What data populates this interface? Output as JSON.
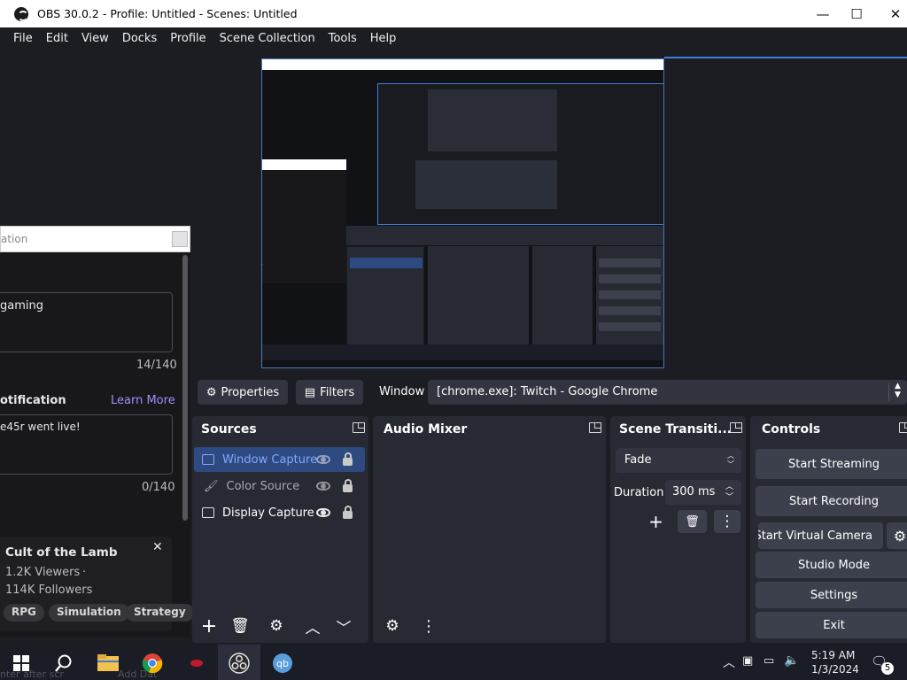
{
  "window": {
    "title": "OBS 30.0.2 - Profile: Untitled - Scenes: Untitled",
    "minimize": "—",
    "maximize": "☐",
    "close": "✕"
  },
  "menu": [
    "File",
    "Edit",
    "View",
    "Docks",
    "Profile",
    "Scene Collection",
    "Tools",
    "Help"
  ],
  "background_window": {
    "title_fragment": "ation",
    "field1_value": "gaming",
    "field1_count": "14/140",
    "section_label": "otification",
    "learn_more": "Learn More",
    "field2_value": "e45r went live!",
    "field2_count": "0/140",
    "card": {
      "title": "Cult of the Lamb",
      "close": "✕",
      "viewers": "1.2K Viewers",
      "dot": "·",
      "followers": "114K Followers",
      "tags": [
        "RPG",
        "Simulation",
        "Strategy"
      ]
    }
  },
  "source_toolbar": {
    "properties": "Properties",
    "filters": "Filters",
    "window_label": "Window",
    "window_value": "[chrome.exe]: Twitch - Google Chrome"
  },
  "sources": {
    "title": "Sources",
    "items": [
      {
        "label": "Window Capture",
        "selected": true,
        "visible": false
      },
      {
        "label": "Color Source",
        "selected": false,
        "visible": false
      },
      {
        "label": "Display Capture",
        "selected": false,
        "visible": true
      }
    ]
  },
  "audio_mixer": {
    "title": "Audio Mixer"
  },
  "scene_transitions": {
    "title": "Scene Transiti...",
    "transition": "Fade",
    "duration_label": "Duration",
    "duration_value": "300 ms"
  },
  "controls": {
    "title": "Controls",
    "start_streaming": "Start Streaming",
    "start_recording": "Start Recording",
    "start_virtual_camera": "Start Virtual Camera",
    "studio_mode": "Studio Mode",
    "settings": "Settings",
    "exit": "Exit"
  },
  "taskbar": {
    "time": "5:19 AM",
    "date": "1/3/2024",
    "notifications": "5",
    "bg_text_1": "nter after scr",
    "bg_text_2": "Add Dat"
  },
  "colors": {
    "accent": "#3b7fd8",
    "dock_bg": "#272a33",
    "app_bg": "#1c1d22",
    "button": "#3c404d"
  }
}
